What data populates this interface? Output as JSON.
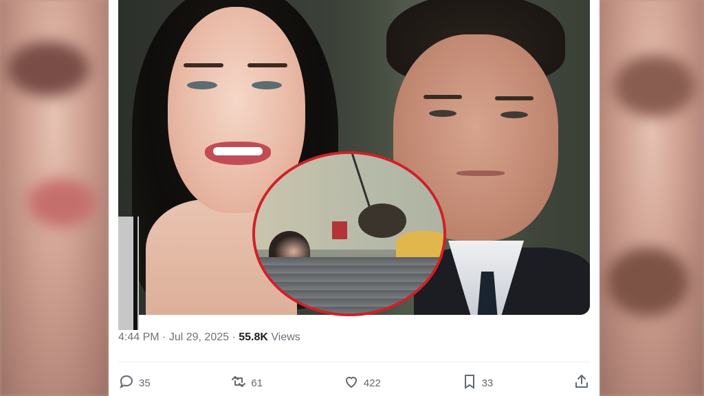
{
  "post": {
    "time": "4:44 PM",
    "separator": "·",
    "date": "Jul 29, 2025",
    "views_count": "55.8K",
    "views_label": "Views"
  },
  "actions": {
    "replies": "35",
    "reposts": "61",
    "likes": "422",
    "bookmarks": "33"
  },
  "colors": {
    "inset_ring": "#d11f26",
    "muted_text": "#6b7279"
  }
}
